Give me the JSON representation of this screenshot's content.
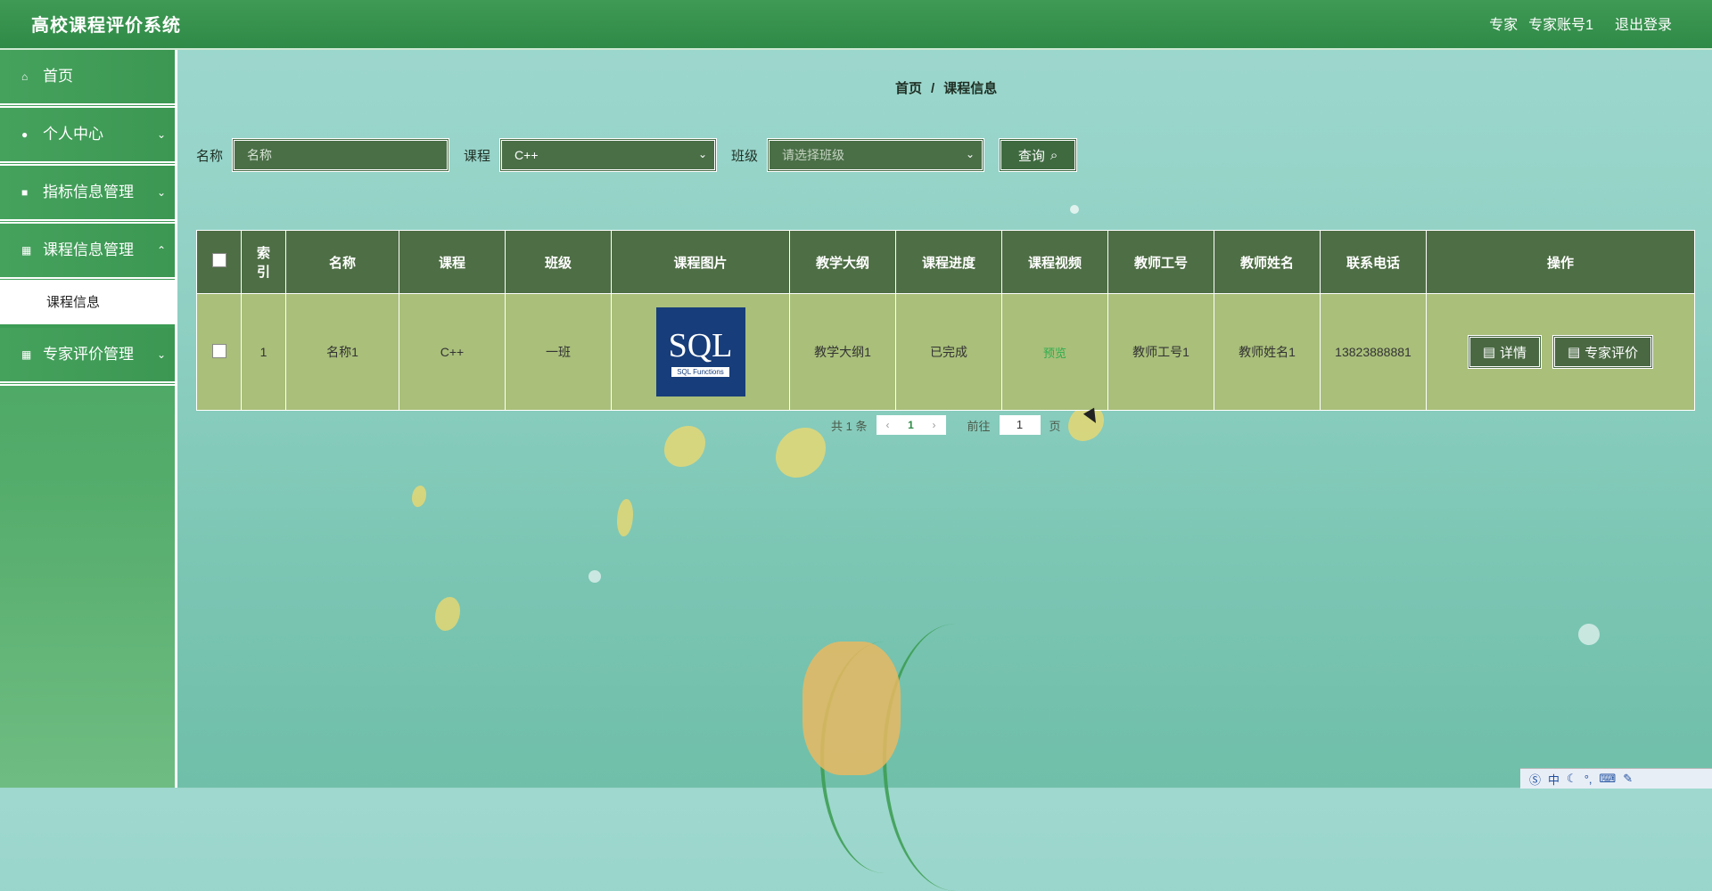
{
  "header": {
    "app_title": "高校课程评价系统",
    "role": "专家",
    "account": "专家账号1",
    "logout": "退出登录"
  },
  "sidebar": {
    "items": [
      {
        "label": "首页",
        "icon": "home-icon"
      },
      {
        "label": "个人中心",
        "icon": "user-icon"
      },
      {
        "label": "指标信息管理",
        "icon": "comment-icon"
      },
      {
        "label": "课程信息管理",
        "icon": "grid-icon"
      },
      {
        "label": "专家评价管理",
        "icon": "grid-icon"
      }
    ],
    "submenu_active": "课程信息"
  },
  "breadcrumb": {
    "home": "首页",
    "sep": "/",
    "current": "课程信息"
  },
  "search": {
    "name_label": "名称",
    "name_placeholder": "名称",
    "course_label": "课程",
    "course_value": "C++",
    "class_label": "班级",
    "class_placeholder": "请选择班级",
    "query_label": "查询"
  },
  "table": {
    "headers": [
      "索引",
      "名称",
      "课程",
      "班级",
      "课程图片",
      "教学大纲",
      "课程进度",
      "课程视频",
      "教师工号",
      "教师姓名",
      "联系电话",
      "操作"
    ],
    "rows": [
      {
        "index": "1",
        "name": "名称1",
        "course": "C++",
        "class": "一班",
        "image_text": "SQL",
        "image_subtext": "SQL Functions",
        "syllabus": "教学大纲1",
        "progress": "已完成",
        "video": "预览",
        "teacher_id": "教师工号1",
        "teacher_name": "教师姓名1",
        "phone": "13823888881",
        "detail_btn": "详情",
        "review_btn": "专家评价"
      }
    ]
  },
  "pagination": {
    "total_prefix": "共",
    "total": "1",
    "total_suffix": "条",
    "current_page": "1",
    "goto_label": "前往",
    "goto_value": "1",
    "page_suffix": "页"
  },
  "ime": {
    "mode": "中"
  },
  "colors": {
    "header": "#2f8a47",
    "table_header": "#4e6e45",
    "table_row": "#a9bf7a"
  }
}
